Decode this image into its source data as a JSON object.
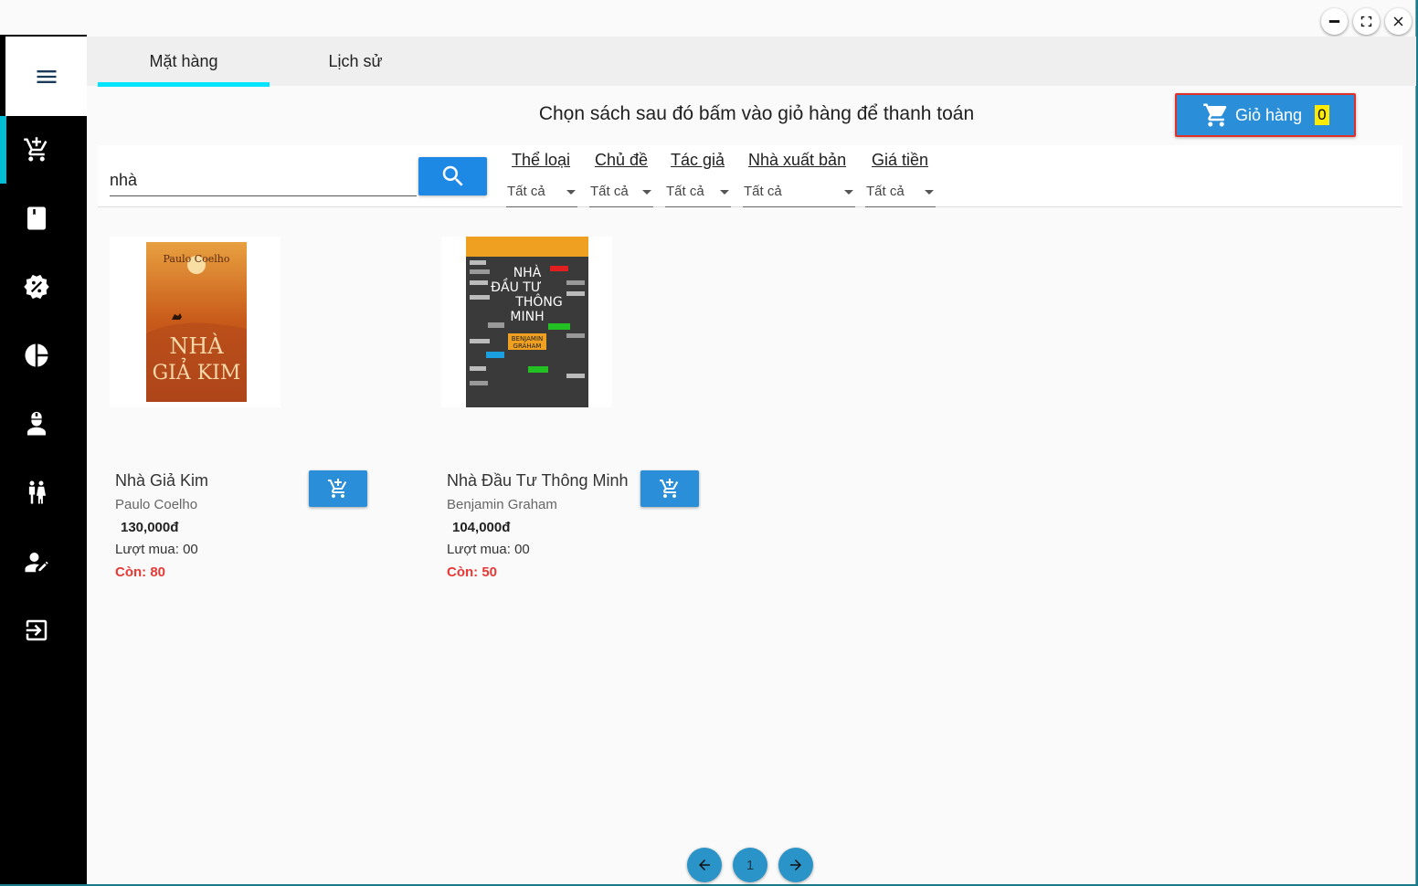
{
  "window_controls": {
    "minimize_icon": "minimize-icon",
    "maximize_icon": "fullscreen-icon",
    "close_icon": "close-icon"
  },
  "sidebar": {
    "items": [
      {
        "icon": "cart-icon"
      },
      {
        "icon": "book-icon"
      },
      {
        "icon": "discount-icon"
      },
      {
        "icon": "pie-chart-icon"
      },
      {
        "icon": "employee-icon"
      },
      {
        "icon": "customers-icon"
      },
      {
        "icon": "edit-user-icon"
      },
      {
        "icon": "logout-icon"
      }
    ]
  },
  "tabs": [
    {
      "label": "Mặt hàng",
      "active": true
    },
    {
      "label": "Lịch sử",
      "active": false
    }
  ],
  "heading": "Chọn sách sau đó bấm vào giỏ hàng để thanh toán",
  "cart": {
    "label": "Giỏ hàng",
    "count": "0"
  },
  "search": {
    "value": "nhà"
  },
  "filters": [
    {
      "label": "Thể loại",
      "value": "Tất cả"
    },
    {
      "label": "Chủ đề",
      "value": "Tất cả"
    },
    {
      "label": "Tác giả",
      "value": "Tất cả"
    },
    {
      "label": "Nhà xuất bản",
      "value": "Tất cả"
    },
    {
      "label": "Giá tiền",
      "value": "Tất cả"
    }
  ],
  "products": [
    {
      "name": "Nhà Giả Kim",
      "author": "Paulo Coelho",
      "price": "130,000đ",
      "sold": "Lượt mua: 00",
      "stock": "Còn: 80",
      "cover": {
        "top_text": "Paulo Coelho",
        "title_line1": "NHÀ",
        "title_line2": "GIẢ KIM"
      }
    },
    {
      "name": "Nhà Đầu Tư Thông Minh",
      "author": "Benjamin Graham",
      "price": "104,000đ",
      "sold": "Lượt mua: 00",
      "stock": "Còn: 50",
      "cover": {
        "title_line1": "NHÀ",
        "title_line2": "ĐẦU TƯ",
        "title_line3": "THÔNG",
        "title_line4": "MINH",
        "author_line1": "BENJAMIN",
        "author_line2": "GRAHAM"
      }
    }
  ],
  "pagination": {
    "current_page": "1"
  },
  "colors": {
    "accent": "#00e5ff",
    "primary_button": "#2a8fd8",
    "stock_red": "#e53935",
    "cart_badge": "#ffeb00"
  }
}
